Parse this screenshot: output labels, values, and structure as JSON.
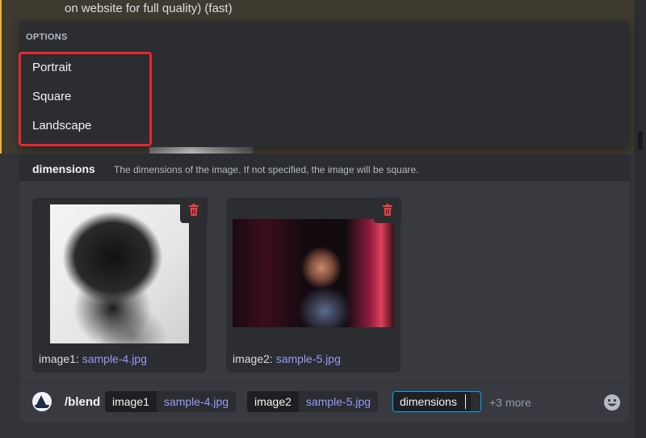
{
  "message": {
    "text": "on website for full quality) (fast)"
  },
  "options_menu": {
    "header": "OPTIONS",
    "items": [
      "Portrait",
      "Square",
      "Landscape"
    ]
  },
  "option_hint": {
    "name": "dimensions",
    "description": "The dimensions of the image. If not specified, the image will be square."
  },
  "attachments": [
    {
      "label": "image1:",
      "file": "sample-4.jpg"
    },
    {
      "label": "image2:",
      "file": "sample-5.jpg"
    }
  ],
  "command": {
    "name": "/blend",
    "params": [
      {
        "key": "image1",
        "value": "sample-4.jpg"
      },
      {
        "key": "image2",
        "value": "sample-5.jpg"
      }
    ],
    "active_param": "dimensions",
    "more": "+3 more"
  },
  "colors": {
    "highlight_box": "#e8272c",
    "link": "#949cf7",
    "mention_bar": "#f0b232",
    "focus_border": "#00a8fc",
    "delete_icon": "#f23f43"
  },
  "icons": {
    "delete": "trash-icon",
    "emoji": "smiley-icon",
    "bot": "sailboat-avatar"
  }
}
